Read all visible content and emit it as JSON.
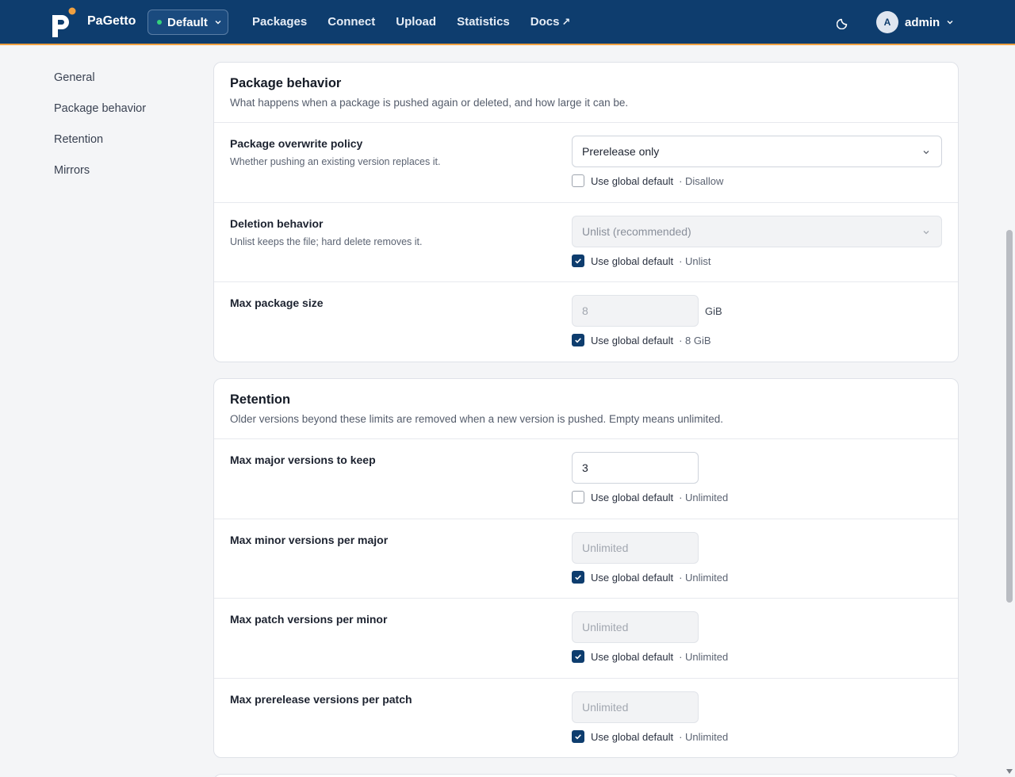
{
  "app": {
    "brand": "PaGetto"
  },
  "feed_selector": {
    "value": "Default"
  },
  "nav": [
    {
      "label": "Packages"
    },
    {
      "label": "Connect"
    },
    {
      "label": "Upload"
    },
    {
      "label": "Statistics"
    },
    {
      "label": "Docs",
      "external_glyph": "↗"
    }
  ],
  "user": {
    "avatar_initial": "A",
    "name": "admin"
  },
  "sidebar": [
    {
      "label": "General"
    },
    {
      "label": "Package behavior"
    },
    {
      "label": "Retention"
    },
    {
      "label": "Mirrors"
    }
  ],
  "package_behavior": {
    "title": "Package behavior",
    "description": "What happens when a package is pushed again or deleted, and how large it can be.",
    "overwrite": {
      "label": "Package overwrite policy",
      "help": "Whether pushing an existing version replaces it.",
      "value": "Prerelease only",
      "use_global_label": "Use global default",
      "use_global_checked": false,
      "global_hint": "· Disallow"
    },
    "deletion": {
      "label": "Deletion behavior",
      "help": "Unlist keeps the file; hard delete removes it.",
      "value": "Unlist (recommended)",
      "use_global_label": "Use global default",
      "use_global_checked": true,
      "global_hint": "· Unlist"
    },
    "max_size": {
      "label": "Max package size",
      "placeholder": "8",
      "unit": "GiB",
      "use_global_label": "Use global default",
      "use_global_checked": true,
      "global_hint": "· 8 GiB"
    }
  },
  "retention": {
    "title": "Retention",
    "description": "Older versions beyond these limits are removed when a new version is pushed. Empty means unlimited.",
    "major": {
      "label": "Max major versions to keep",
      "value": "3",
      "use_global_label": "Use global default",
      "use_global_checked": false,
      "global_hint": "· Unlimited"
    },
    "minor": {
      "label": "Max minor versions per major",
      "placeholder": "Unlimited",
      "use_global_label": "Use global default",
      "use_global_checked": true,
      "global_hint": "· Unlimited"
    },
    "patch": {
      "label": "Max patch versions per minor",
      "placeholder": "Unlimited",
      "use_global_label": "Use global default",
      "use_global_checked": true,
      "global_hint": "· Unlimited"
    },
    "prerelease": {
      "label": "Max prerelease versions per patch",
      "placeholder": "Unlimited",
      "use_global_label": "Use global default",
      "use_global_checked": true,
      "global_hint": "· Unlimited"
    }
  },
  "colors": {
    "header": "#0e3d6e",
    "accent": "#f0a040",
    "status_dot": "#34d27b"
  }
}
